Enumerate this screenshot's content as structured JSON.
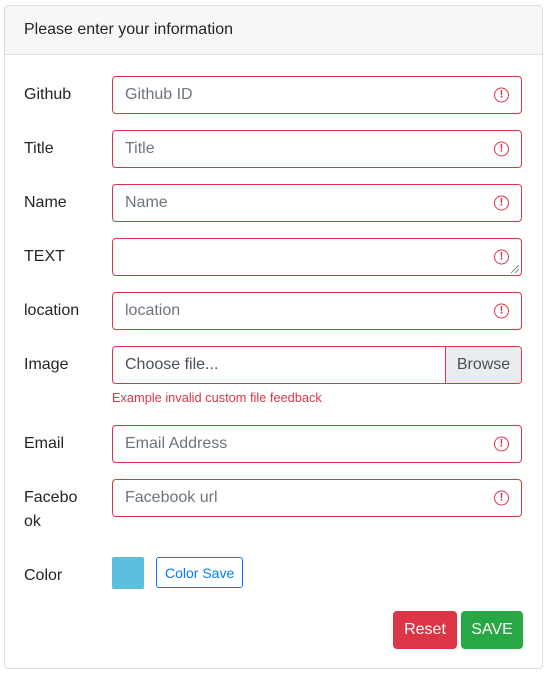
{
  "header": {
    "title": "Please enter your information"
  },
  "fields": {
    "github": {
      "label": "Github",
      "placeholder": "Github ID"
    },
    "title": {
      "label": "Title",
      "placeholder": "Title"
    },
    "name": {
      "label": "Name",
      "placeholder": "Name"
    },
    "text": {
      "label": "TEXT",
      "placeholder": ""
    },
    "location": {
      "label": "location",
      "placeholder": "location"
    },
    "image": {
      "label": "Image",
      "file_label": "Choose file...",
      "browse_label": "Browse",
      "feedback": "Example invalid custom file feedback"
    },
    "email": {
      "label": "Email",
      "placeholder": "Email Address"
    },
    "facebook": {
      "label_line1": "Facebo",
      "label_line2": "ok",
      "placeholder": "Facebook url"
    },
    "color": {
      "label": "Color",
      "value": "#5bc0de",
      "save_label": "Color Save"
    }
  },
  "error_icon_glyph": "!",
  "actions": {
    "reset_label": "Reset",
    "save_label": "SAVE"
  },
  "colors": {
    "invalid": "#dc3545",
    "save": "#28a745",
    "primary": "#007bff"
  }
}
